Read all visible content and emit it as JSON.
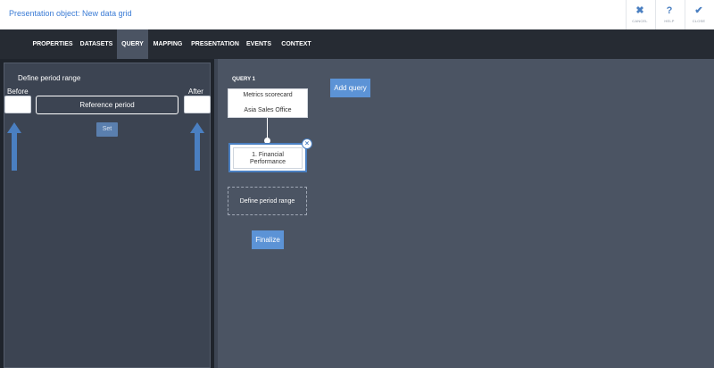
{
  "header": {
    "title": "Presentation object: New data grid",
    "buttons": [
      {
        "label": "CANCEL",
        "icon": "close-icon",
        "glyph": "✖"
      },
      {
        "label": "HELP",
        "icon": "help-icon",
        "glyph": "?"
      },
      {
        "label": "CLOSE",
        "icon": "check-icon",
        "glyph": "✔"
      }
    ]
  },
  "tabs": [
    {
      "label": "PROPERTIES"
    },
    {
      "label": "DATASETS"
    },
    {
      "label": "QUERY",
      "active": true
    },
    {
      "label": "MAPPING"
    },
    {
      "label": "PRESENTATION"
    },
    {
      "label": "EVENTS"
    },
    {
      "label": "CONTEXT"
    }
  ],
  "left_panel": {
    "title": "Define period range",
    "before_label": "Before",
    "after_label": "After",
    "reference_period": "Reference period",
    "set_label": "Set",
    "before_value": "",
    "after_value": ""
  },
  "canvas": {
    "query_label": "QUERY 1",
    "main_node": {
      "line1": "Metrics scorecard",
      "line2": "Asia Sales Office"
    },
    "perf_node": {
      "line1": "1. Financial",
      "line2": "Performance"
    },
    "define_node": "Define period range",
    "finalize_label": "Finalize",
    "add_query_label": "Add query"
  },
  "colors": {
    "accent": "#5c93d6",
    "background": "#4b5463",
    "tabbar": "#262b33",
    "arrow": "#4a7fc1"
  }
}
